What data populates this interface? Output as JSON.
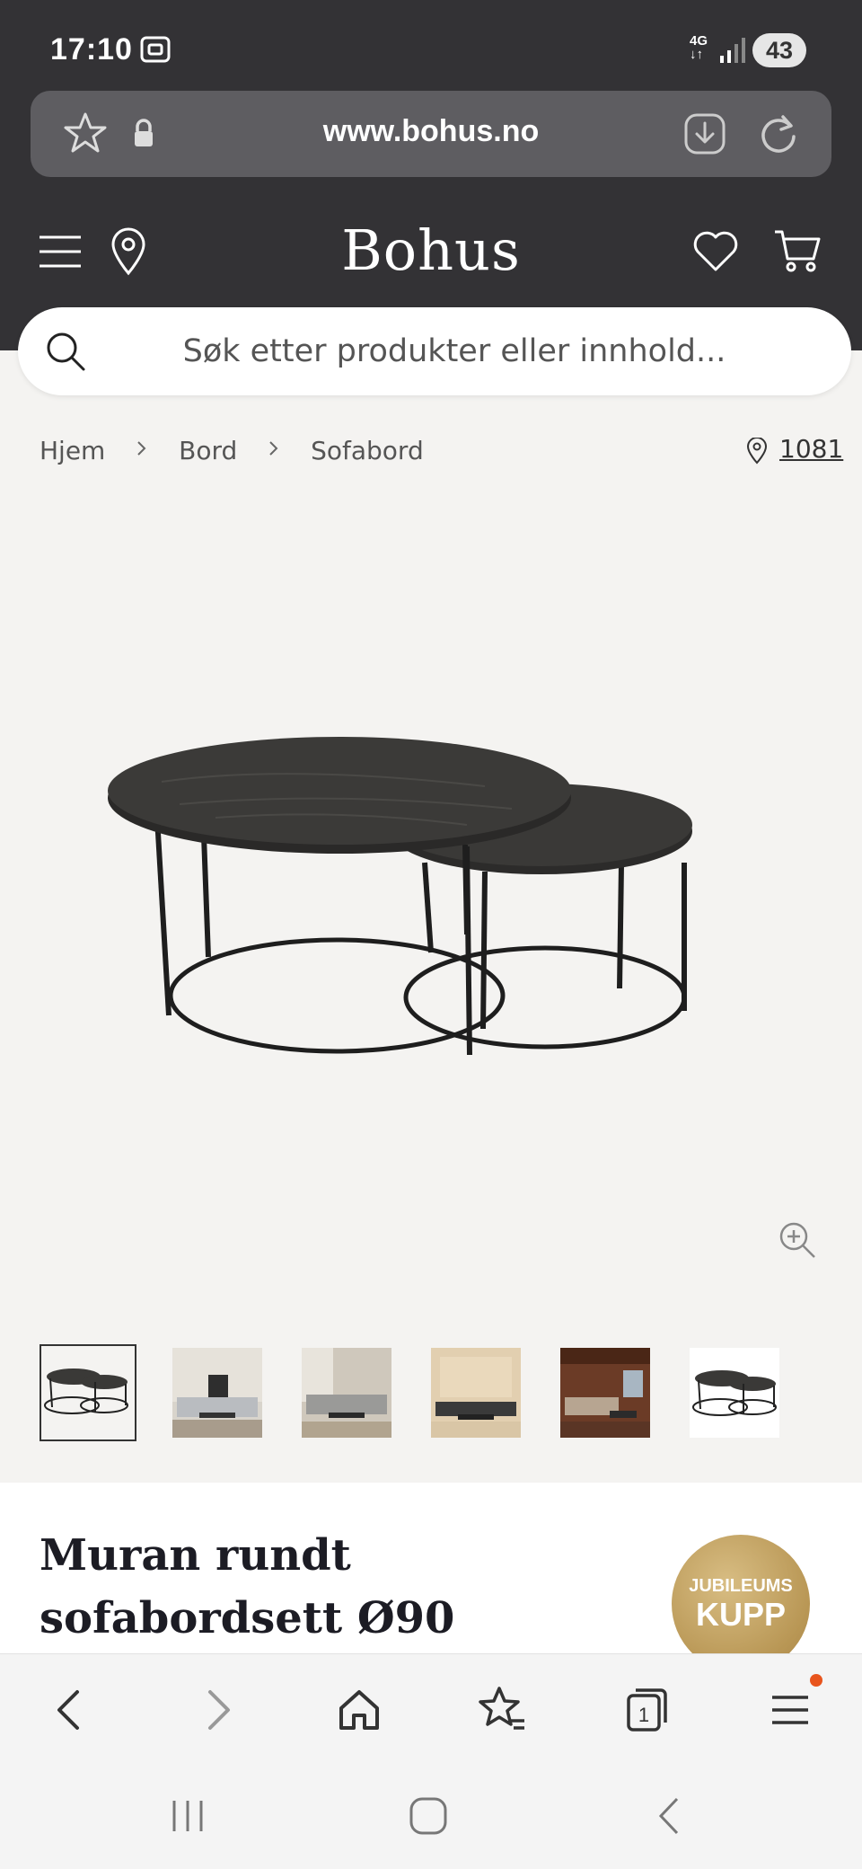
{
  "status_bar": {
    "time": "17:10",
    "network": "4G",
    "battery": "43"
  },
  "browser": {
    "url": "www.bohus.no"
  },
  "header": {
    "logo": "Bohus"
  },
  "search": {
    "placeholder": "Søk etter produkter eller innhold..."
  },
  "breadcrumb": {
    "items": [
      "Hjem",
      "Bord",
      "Sofabord"
    ]
  },
  "location": {
    "postcode": "1081"
  },
  "product": {
    "title": "Muran rundt sofabordsett Ø90",
    "badge_line1": "JUBILEUMS",
    "badge_line2": "KUPP"
  },
  "thumbnails": [
    {
      "name": "table-set-product",
      "active": true
    },
    {
      "name": "room-grey-sofa-1",
      "active": false
    },
    {
      "name": "room-grey-sofa-2",
      "active": false
    },
    {
      "name": "room-beige-wall",
      "active": false
    },
    {
      "name": "room-wood-cabin",
      "active": false
    },
    {
      "name": "table-set-product-alt",
      "active": false
    }
  ],
  "colors": {
    "header_bg": "#333235",
    "badge_gold": "#b89654",
    "notification_dot": "#e8541c"
  }
}
